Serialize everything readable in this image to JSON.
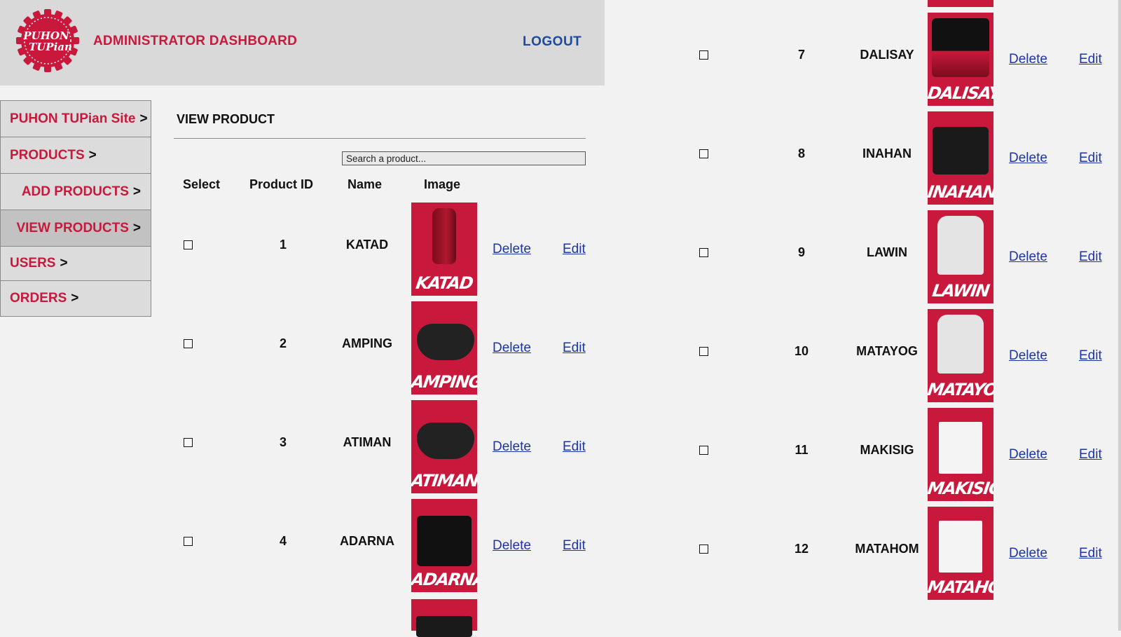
{
  "header": {
    "logo_text_line1": "PUHON",
    "logo_text_line2": "TUPian",
    "title": "ADMINISTRATOR DASHBOARD",
    "logout_label": "LOGOUT"
  },
  "sidebar": {
    "items": [
      {
        "label": "PUHON TUPian Site",
        "arrow": ">"
      },
      {
        "label": "PRODUCTS",
        "arrow": ">"
      },
      {
        "label": "ADD PRODUCTS",
        "arrow": ">"
      },
      {
        "label": "VIEW PRODUCTS",
        "arrow": ">"
      },
      {
        "label": "USERS",
        "arrow": ">"
      },
      {
        "label": "ORDERS",
        "arrow": ">"
      }
    ]
  },
  "main": {
    "section_title": "VIEW PRODUCT",
    "search": {
      "placeholder": "Search a product..."
    },
    "columns": [
      "Select",
      "Product ID",
      "Name",
      "Image"
    ],
    "delete_label": "Delete",
    "edit_label": "Edit",
    "rows": [
      {
        "id": "1",
        "name": "KATAD",
        "image_caption": "KATAD",
        "image_icon": "spray-bottle"
      },
      {
        "id": "2",
        "name": "AMPING",
        "image_caption": "AMPING",
        "image_icon": "face-mask"
      },
      {
        "id": "3",
        "name": "ATIMAN",
        "image_caption": "ATIMAN",
        "image_icon": "face-mask"
      },
      {
        "id": "4",
        "name": "ADARNA",
        "image_caption": "ADARNA",
        "image_icon": "bird-print"
      },
      {
        "id": "7",
        "name": "DALISAY",
        "image_caption": "DALISAY",
        "image_icon": "skyline-print"
      },
      {
        "id": "8",
        "name": "INAHAN",
        "image_caption": "INAHAN",
        "image_icon": "gray-hawks-print"
      },
      {
        "id": "9",
        "name": "LAWIN",
        "image_caption": "LAWIN",
        "image_icon": "t-shirt"
      },
      {
        "id": "10",
        "name": "MATAYOG",
        "image_caption": "MATAYOG",
        "image_icon": "t-shirt"
      },
      {
        "id": "11",
        "name": "MAKISIG",
        "image_caption": "MAKISIG",
        "image_icon": "tote-bag"
      },
      {
        "id": "12",
        "name": "MATAHOM",
        "image_caption": "MATAHOM",
        "image_icon": "tote-bag"
      }
    ]
  },
  "colors": {
    "brand_red": "#c8193c",
    "link_blue": "#1d34a8",
    "logout_blue": "#1c4aa0",
    "header_bg": "#d9d9d9",
    "page_bg": "#f2f2f2"
  }
}
